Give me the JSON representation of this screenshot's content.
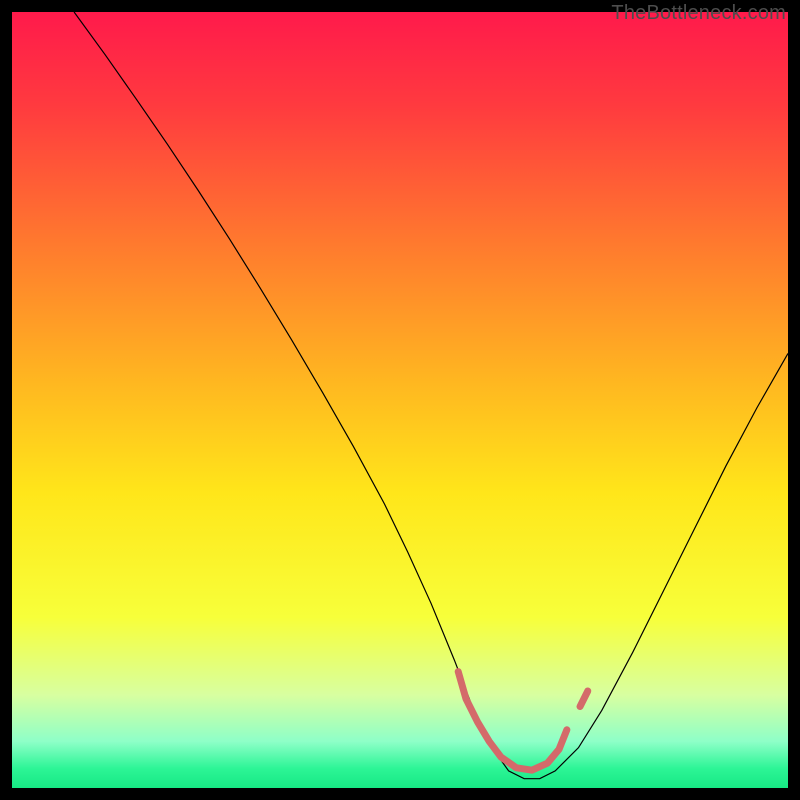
{
  "watermark": "TheBottleneck.com",
  "chart_data": {
    "type": "line",
    "title": "",
    "xlabel": "",
    "ylabel": "",
    "xlim": [
      0,
      100
    ],
    "ylim": [
      0,
      100
    ],
    "background_gradient": {
      "stops": [
        {
          "offset": 0.0,
          "color": "#ff1a4b"
        },
        {
          "offset": 0.12,
          "color": "#ff3a3f"
        },
        {
          "offset": 0.3,
          "color": "#ff7a2e"
        },
        {
          "offset": 0.48,
          "color": "#ffb820"
        },
        {
          "offset": 0.62,
          "color": "#ffe61a"
        },
        {
          "offset": 0.78,
          "color": "#f7ff3a"
        },
        {
          "offset": 0.88,
          "color": "#d8ffa0"
        },
        {
          "offset": 0.94,
          "color": "#8effc8"
        },
        {
          "offset": 0.975,
          "color": "#2cf596"
        },
        {
          "offset": 1.0,
          "color": "#17e884"
        }
      ]
    },
    "series": [
      {
        "name": "bottleneck-curve",
        "color": "#000000",
        "width": 1.2,
        "x": [
          8,
          12,
          16,
          20,
          24,
          28,
          32,
          36,
          40,
          44,
          48,
          51,
          54,
          57,
          59.5,
          62,
          64,
          66,
          68,
          70,
          73,
          76,
          80,
          84,
          88,
          92,
          96,
          100
        ],
        "y": [
          100,
          94.5,
          88.8,
          83,
          77,
          70.8,
          64.4,
          57.8,
          51,
          44,
          36.6,
          30.4,
          23.8,
          16.5,
          10,
          5,
          2.2,
          1.2,
          1.2,
          2.2,
          5.2,
          10,
          17.5,
          25.5,
          33.5,
          41.5,
          49,
          56
        ]
      },
      {
        "name": "optimal-zone-marker",
        "color": "#d46a6a",
        "width": 7,
        "linecap": "round",
        "x": [
          57.5,
          58.5,
          60,
          61.5,
          63,
          65,
          67,
          69,
          70.5,
          71.5
        ],
        "y": [
          15,
          11.5,
          8.5,
          6,
          4,
          2.6,
          2.3,
          3.2,
          5,
          7.5
        ]
      },
      {
        "name": "optimal-zone-right-dot",
        "color": "#d46a6a",
        "width": 7,
        "linecap": "round",
        "x": [
          73.2,
          74.2
        ],
        "y": [
          10.5,
          12.5
        ]
      }
    ]
  }
}
